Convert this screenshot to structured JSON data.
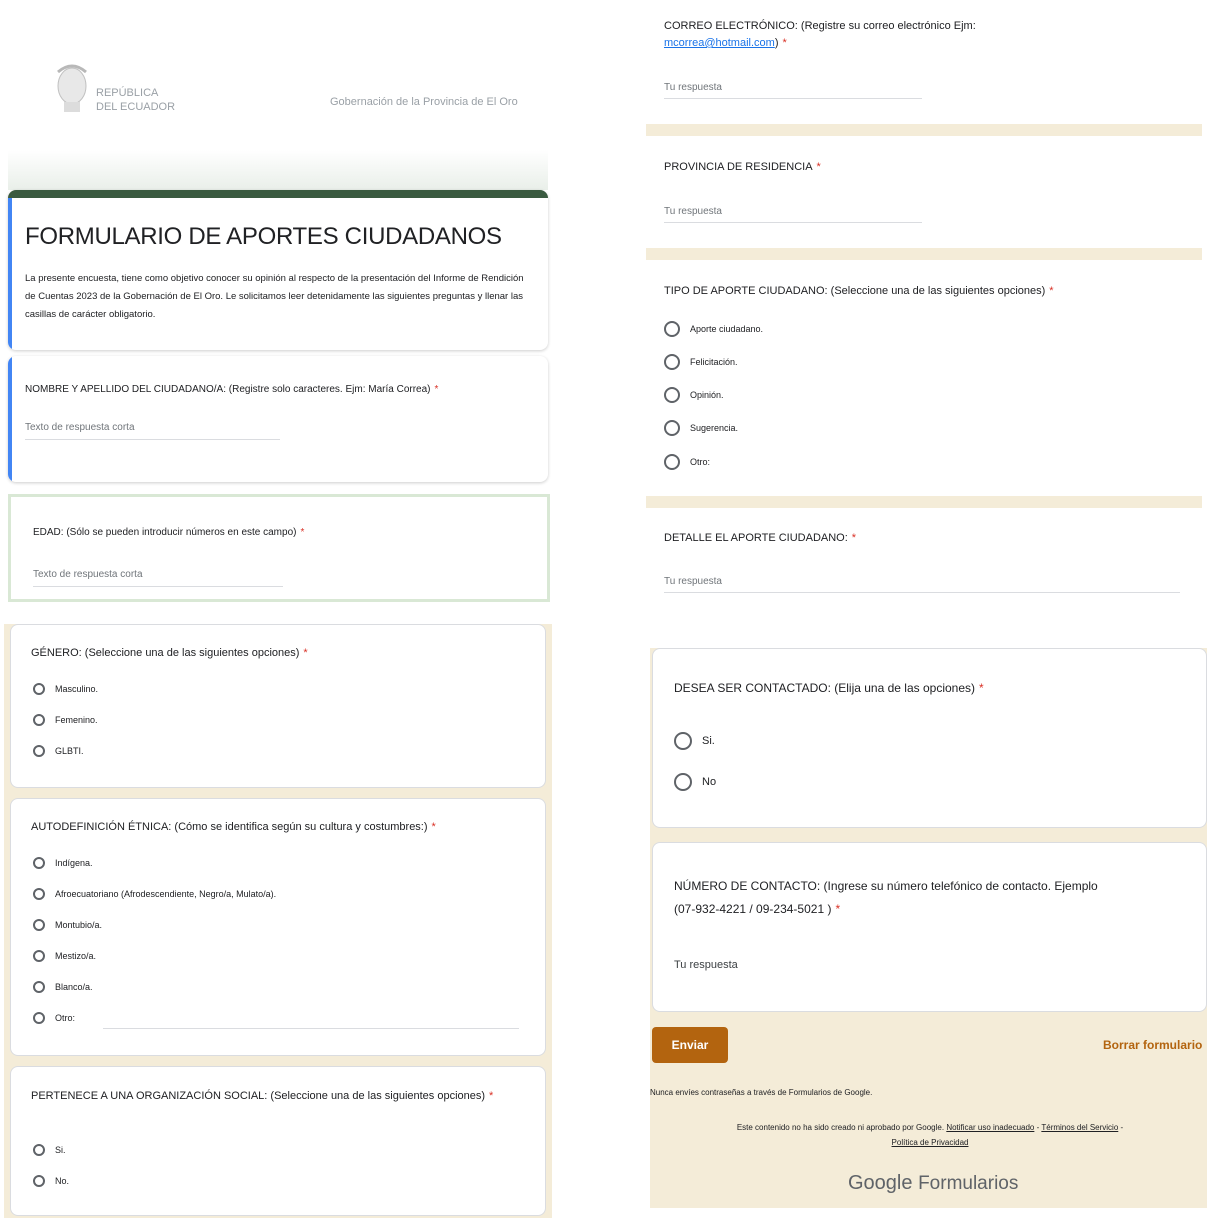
{
  "header": {
    "logo_line1": "REPÚBLICA",
    "logo_line2": "DEL ECUADOR",
    "org": "Gobernación de la Provincia de El Oro"
  },
  "form": {
    "title": "FORMULARIO DE APORTES CIUDADANOS",
    "description": "La presente encuesta, tiene como objetivo conocer su opinión al respecto de la presentación del Informe de Rendición de Cuentas 2023 de la Gobernación de El Oro. Le solicitamos leer detenidamente las siguientes preguntas y llenar las casillas de carácter obligatorio."
  },
  "required_mark": "*",
  "q_nombre": {
    "label": "NOMBRE Y APELLIDO DEL CIUDADANO/A: (Registre solo caracteres. Ejm: María Correa)",
    "placeholder": "Texto de respuesta corta"
  },
  "q_edad": {
    "label": "EDAD: (Sólo se pueden introducir números en este campo)",
    "placeholder": "Texto de respuesta corta"
  },
  "q_genero": {
    "label": "GÉNERO: (Seleccione una de las siguientes opciones)",
    "options": [
      "Masculino.",
      "Femenino.",
      "GLBTI."
    ]
  },
  "q_etnica": {
    "label": "AUTODEFINICIÓN ÉTNICA: (Cómo se identifica según su cultura y costumbres:)",
    "options": [
      "Indígena.",
      "Afroecuatoriano (Afrodescendiente, Negro/a, Mulato/a).",
      "Montubio/a.",
      "Mestizo/a.",
      "Blanco/a.",
      "Otro:"
    ]
  },
  "q_org": {
    "label": "PERTENECE A UNA ORGANIZACIÓN SOCIAL: (Seleccione una de las siguientes opciones)",
    "options": [
      "Si.",
      "No."
    ]
  },
  "q_correo": {
    "label": "CORREO ELECTRÓNICO: (Registre su correo electrónico Ejm:",
    "email": "mcorrea@hotmail.com",
    "label_end": ")",
    "placeholder": "Tu respuesta"
  },
  "q_provincia": {
    "label": "PROVINCIA DE RESIDENCIA",
    "placeholder": "Tu respuesta"
  },
  "q_tipo": {
    "label": "TIPO DE APORTE CIUDADANO: (Seleccione una de las siguientes opciones)",
    "options": [
      "Aporte ciudadano.",
      "Felicitación.",
      "Opinión.",
      "Sugerencia.",
      "Otro:"
    ]
  },
  "q_detalle": {
    "label": "DETALLE EL APORTE CIUDADANO:",
    "placeholder": "Tu respuesta"
  },
  "q_contacto": {
    "label": "DESEA SER CONTACTADO: (Elija una de las opciones)",
    "options": [
      "Si.",
      "No"
    ]
  },
  "q_numero": {
    "label_line1": "NÚMERO DE CONTACTO: (Ingrese su número telefónico de contacto. Ejemplo",
    "label_line2": "(07-932-4221 / 09-234-5021 )",
    "placeholder": "Tu respuesta"
  },
  "footer": {
    "submit": "Enviar",
    "clear": "Borrar formulario",
    "warning": "Nunca envíes contraseñas a través de Formularios de Google.",
    "disclaimer": "Este contenido no ha sido creado ni aprobado por Google.",
    "report": "Notificar uso inadecuado",
    "sep": "-",
    "terms": "Términos del Servicio",
    "privacy": "Política de Privacidad",
    "brand_google": "Google",
    "brand_forms": "Formularios"
  },
  "colors": {
    "accent_green": "#3a5a40",
    "accent_blue": "#4285f4",
    "submit": "#b3640f",
    "clear": "#b3640f",
    "beige": "#f4ecd8"
  }
}
